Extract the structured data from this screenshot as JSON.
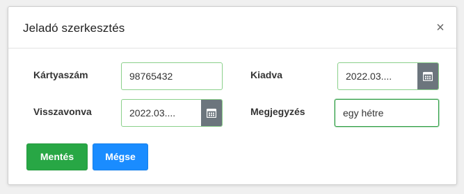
{
  "dialog": {
    "title": "Jeladó szerkesztés",
    "close_glyph": "×"
  },
  "form": {
    "card_number": {
      "label": "Kártyaszám",
      "value": "98765432"
    },
    "issued": {
      "label": "Kiadva",
      "value": "2022.03...."
    },
    "revoked": {
      "label": "Visszavonva",
      "value": "2022.03...."
    },
    "note": {
      "label": "Megjegyzés",
      "value": "egy hétre"
    }
  },
  "buttons": {
    "save_label": "Mentés",
    "cancel_label": "Mégse"
  },
  "icons": {
    "calendar": "calendar-icon",
    "close": "close-icon"
  },
  "colors": {
    "save": "#28a745",
    "cancel": "#1a8cff",
    "field_border": "#8ad08a",
    "focused_border": "#2f9e44",
    "calendar_button": "#6c757d"
  }
}
